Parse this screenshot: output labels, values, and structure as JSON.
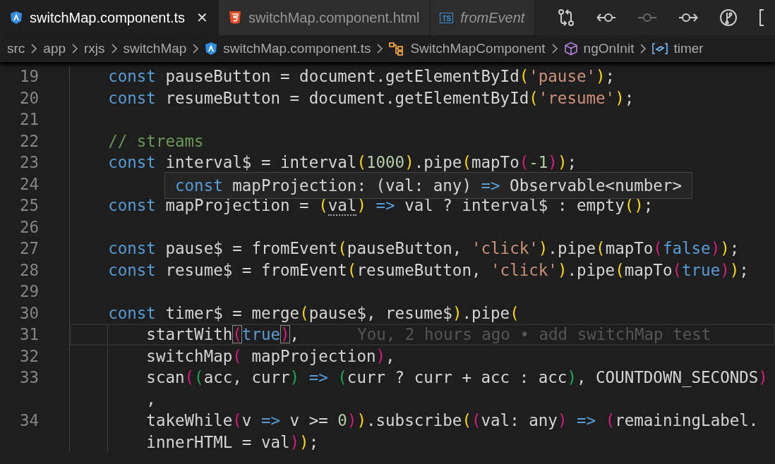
{
  "tabs": [
    {
      "label": "switchMap.component.ts",
      "kind": "angular",
      "selected": true,
      "preview": false,
      "close_glyph": "✕"
    },
    {
      "label": "switchMap.component.html",
      "kind": "html",
      "selected": false,
      "preview": false
    },
    {
      "label": "fromEvent",
      "kind": "typescript",
      "badge": "TS",
      "selected": false,
      "preview": true
    }
  ],
  "toolbar": [
    {
      "kind": "compare",
      "disabled": false
    },
    {
      "kind": "back",
      "disabled": false
    },
    {
      "kind": "commit",
      "disabled": true
    },
    {
      "kind": "forward",
      "disabled": false
    },
    {
      "kind": "branch",
      "disabled": false
    },
    {
      "kind": "split",
      "disabled": false
    }
  ],
  "breadcrumb": [
    {
      "label": "src",
      "kind": "folder"
    },
    {
      "label": "app",
      "kind": "folder"
    },
    {
      "label": "rxjs",
      "kind": "folder"
    },
    {
      "label": "switchMap",
      "kind": "folder"
    },
    {
      "label": "switchMap.component.ts",
      "kind": "angular"
    },
    {
      "label": "SwitchMapComponent",
      "kind": "class"
    },
    {
      "label": "ngOnInit",
      "kind": "method"
    },
    {
      "label": "timer",
      "kind": "variable"
    }
  ],
  "lines": [
    {
      "number": "19",
      "current": false,
      "tokens": [
        {
          "text": "    const",
          "kind": "keyword"
        },
        {
          "text": " pauseButton = document.getElementById",
          "kind": "text"
        },
        {
          "text": "(",
          "kind": "bracket1"
        },
        {
          "text": "'pause'",
          "kind": "string"
        },
        {
          "text": ")",
          "kind": "bracket1"
        },
        {
          "text": ";",
          "kind": "text"
        }
      ]
    },
    {
      "number": "20",
      "current": false,
      "tokens": [
        {
          "text": "    const",
          "kind": "keyword"
        },
        {
          "text": " resumeButton = document.getElementById",
          "kind": "text"
        },
        {
          "text": "(",
          "kind": "bracket1"
        },
        {
          "text": "'resume'",
          "kind": "string"
        },
        {
          "text": ")",
          "kind": "bracket1"
        },
        {
          "text": ";",
          "kind": "text"
        }
      ]
    },
    {
      "number": "21",
      "current": false
    },
    {
      "number": "22",
      "current": false,
      "tokens": [
        {
          "text": "    // streams",
          "kind": "comment"
        }
      ]
    },
    {
      "number": "23",
      "current": false,
      "tokens": [
        {
          "text": "    const",
          "kind": "keyword"
        },
        {
          "text": " interval$ = interval",
          "kind": "text"
        },
        {
          "text": "(",
          "kind": "bracket1"
        },
        {
          "text": "1000",
          "kind": "number"
        },
        {
          "text": ")",
          "kind": "bracket1"
        },
        {
          "text": ".pipe",
          "kind": "text"
        },
        {
          "text": "(",
          "kind": "bracket1"
        },
        {
          "text": "mapTo",
          "kind": "text"
        },
        {
          "text": "(",
          "kind": "bracket2"
        },
        {
          "text": "-1",
          "kind": "number"
        },
        {
          "text": ")",
          "kind": "bracket2"
        },
        {
          "text": ")",
          "kind": "bracket1"
        },
        {
          "text": ";",
          "kind": "text"
        }
      ],
      "hover": {
        "tokens": [
          {
            "text": "const",
            "kind": "keyword"
          },
          {
            "text": " mapProjection: (val: any) ",
            "kind": "text"
          },
          {
            "text": "=>",
            "kind": "keyword"
          },
          {
            "text": " Observable<number>",
            "kind": "text"
          }
        ]
      }
    },
    {
      "number": "24",
      "current": false
    },
    {
      "number": "25",
      "current": false,
      "tokens": [
        {
          "text": "    const",
          "kind": "keyword"
        },
        {
          "text": " mapProjection = ",
          "kind": "text"
        },
        {
          "text": "(",
          "kind": "bracket1"
        },
        {
          "text": "val",
          "kind": "text",
          "hint": true
        },
        {
          "text": ")",
          "kind": "bracket1"
        },
        {
          "text": " => ",
          "kind": "keyword"
        },
        {
          "text": "val ? interval$ : empty",
          "kind": "text"
        },
        {
          "text": "(",
          "kind": "bracket1"
        },
        {
          "text": ")",
          "kind": "bracket1"
        },
        {
          "text": ";",
          "kind": "text"
        }
      ]
    },
    {
      "number": "26",
      "current": false
    },
    {
      "number": "27",
      "current": false,
      "tokens": [
        {
          "text": "    const",
          "kind": "keyword"
        },
        {
          "text": " pause$ = fromEvent",
          "kind": "text"
        },
        {
          "text": "(",
          "kind": "bracket1"
        },
        {
          "text": "pauseButton, ",
          "kind": "text"
        },
        {
          "text": "'click'",
          "kind": "string"
        },
        {
          "text": ")",
          "kind": "bracket1"
        },
        {
          "text": ".pipe",
          "kind": "text"
        },
        {
          "text": "(",
          "kind": "bracket1"
        },
        {
          "text": "mapTo",
          "kind": "text"
        },
        {
          "text": "(",
          "kind": "bracket2"
        },
        {
          "text": "false",
          "kind": "keyword"
        },
        {
          "text": ")",
          "kind": "bracket2"
        },
        {
          "text": ")",
          "kind": "bracket1"
        },
        {
          "text": ";",
          "kind": "text"
        }
      ]
    },
    {
      "number": "28",
      "current": false,
      "tokens": [
        {
          "text": "    const",
          "kind": "keyword"
        },
        {
          "text": " resume$ = fromEvent",
          "kind": "text"
        },
        {
          "text": "(",
          "kind": "bracket1"
        },
        {
          "text": "resumeButton, ",
          "kind": "text"
        },
        {
          "text": "'click'",
          "kind": "string"
        },
        {
          "text": ")",
          "kind": "bracket1"
        },
        {
          "text": ".pipe",
          "kind": "text"
        },
        {
          "text": "(",
          "kind": "bracket1"
        },
        {
          "text": "mapTo",
          "kind": "text"
        },
        {
          "text": "(",
          "kind": "bracket2"
        },
        {
          "text": "true",
          "kind": "keyword"
        },
        {
          "text": ")",
          "kind": "bracket2"
        },
        {
          "text": ")",
          "kind": "bracket1"
        },
        {
          "text": ";",
          "kind": "text"
        }
      ]
    },
    {
      "number": "29",
      "current": false
    },
    {
      "number": "30",
      "current": false,
      "tokens": [
        {
          "text": "    const",
          "kind": "keyword"
        },
        {
          "text": " timer$ = merge",
          "kind": "text"
        },
        {
          "text": "(",
          "kind": "bracket1"
        },
        {
          "text": "pause$, resume$",
          "kind": "text"
        },
        {
          "text": ")",
          "kind": "bracket1"
        },
        {
          "text": ".pipe",
          "kind": "text"
        },
        {
          "text": "(",
          "kind": "bracket1"
        }
      ]
    },
    {
      "number": "31",
      "current": true,
      "blame": "You, 2 hours ago • add switchMap test",
      "tokens": [
        {
          "text": "        startWith",
          "kind": "text"
        },
        {
          "text": "(",
          "kind": "bracket2",
          "matched": true
        },
        {
          "text": "true",
          "kind": "keyword"
        },
        {
          "text": ")",
          "kind": "bracket2",
          "matched": true
        },
        {
          "text": ",",
          "kind": "text"
        }
      ]
    },
    {
      "number": "32",
      "current": false,
      "tokens": [
        {
          "text": "        switchMap",
          "kind": "text"
        },
        {
          "text": "(",
          "kind": "bracket2"
        },
        {
          "text": " mapProjection",
          "kind": "text"
        },
        {
          "text": ")",
          "kind": "bracket2"
        },
        {
          "text": ",",
          "kind": "text"
        }
      ]
    },
    {
      "number": "33",
      "current": false,
      "tokens": [
        {
          "text": "        scan",
          "kind": "text"
        },
        {
          "text": "(",
          "kind": "bracket2"
        },
        {
          "text": "(",
          "kind": "bracket3"
        },
        {
          "text": "acc, curr",
          "kind": "text"
        },
        {
          "text": ")",
          "kind": "bracket3"
        },
        {
          "text": " => ",
          "kind": "keyword"
        },
        {
          "text": "(",
          "kind": "bracket3"
        },
        {
          "text": "curr ? curr + acc : acc",
          "kind": "text"
        },
        {
          "text": ")",
          "kind": "bracket3"
        },
        {
          "text": ", COUNTDOWN_SECONDS",
          "kind": "text"
        },
        {
          "text": ")",
          "kind": "bracket2"
        }
      ],
      "wrapped": [
        {
          "text": "        ,",
          "kind": "text"
        }
      ]
    },
    {
      "number": "34",
      "current": false,
      "tokens": [
        {
          "text": "        takeWhile",
          "kind": "text"
        },
        {
          "text": "(",
          "kind": "bracket2"
        },
        {
          "text": "v ",
          "kind": "text"
        },
        {
          "text": "=>",
          "kind": "keyword"
        },
        {
          "text": " v >= ",
          "kind": "text"
        },
        {
          "text": "0",
          "kind": "number"
        },
        {
          "text": ")",
          "kind": "bracket2"
        },
        {
          "text": ")",
          "kind": "bracket1"
        },
        {
          "text": ".subscribe",
          "kind": "text"
        },
        {
          "text": "(",
          "kind": "bracket1"
        },
        {
          "text": "(",
          "kind": "bracket2"
        },
        {
          "text": "val: any",
          "kind": "text"
        },
        {
          "text": ")",
          "kind": "bracket2"
        },
        {
          "text": " => ",
          "kind": "keyword"
        },
        {
          "text": "(",
          "kind": "bracket2"
        },
        {
          "text": "remainingLabel.",
          "kind": "text"
        }
      ],
      "wrapped": [
        {
          "text": "        innerHTML = val",
          "kind": "text"
        },
        {
          "text": ")",
          "kind": "bracket2"
        },
        {
          "text": ")",
          "kind": "bracket1"
        },
        {
          "text": ";",
          "kind": "text"
        }
      ]
    }
  ]
}
